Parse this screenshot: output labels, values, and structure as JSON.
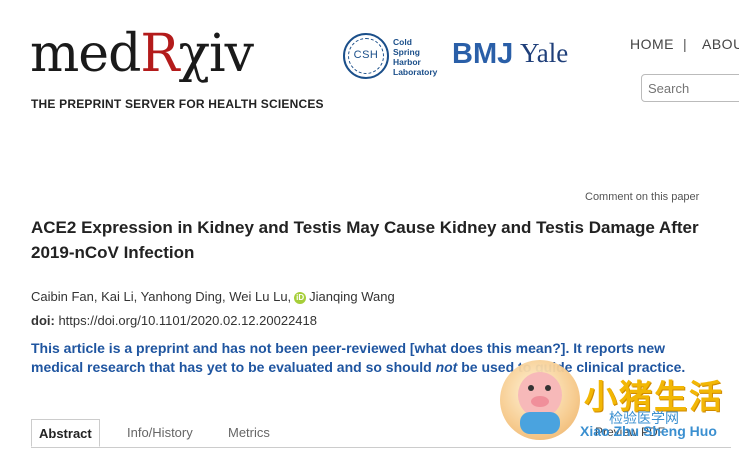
{
  "header": {
    "logo": {
      "part1": "med",
      "part2": "R",
      "part3": "χiv"
    },
    "tagline": "THE PREPRINT SERVER FOR HEALTH SCIENCES",
    "partners": {
      "csh_abbrev": "CSH",
      "csh_lines": [
        "Cold",
        "Spring",
        "Harbor",
        "Laboratory"
      ],
      "bmj": "BMJ",
      "yale": "Yale"
    },
    "nav": {
      "home": "HOME",
      "separator": "|",
      "about": "ABOUT"
    },
    "search": {
      "placeholder": "Search"
    }
  },
  "article": {
    "comment_link": "Comment on this paper",
    "title": "ACE2 Expression in Kidney and Testis May Cause Kidney and Testis Damage After 2019-nCoV Infection",
    "authors_before": "Caibin Fan, Kai Li, Yanhong Ding, Wei Lu Lu,",
    "orcid_badge": "iD",
    "authors_after": "Jianqing Wang",
    "doi_label": "doi:",
    "doi_value": "https://doi.org/10.1101/2020.02.12.20022418",
    "notice": {
      "part1": "This article is a preprint and has not been peer-reviewed [what does this mean?]. It reports new medical research that has yet to be evaluated and so should ",
      "emphasis": "not",
      "part2": " be used to guide clinical practice."
    }
  },
  "tabs": [
    {
      "label": "Abstract",
      "active": true
    },
    {
      "label": "Info/History",
      "active": false
    },
    {
      "label": "Metrics",
      "active": false
    }
  ],
  "preview_pdf": "Preview PDF",
  "watermark": {
    "title": "小猪生活",
    "subtitle": "检验医学网",
    "pinyin": "Xiao Zhu Sheng Huo"
  },
  "colors": {
    "brand_red": "#b31b1b",
    "notice_blue": "#1f55a0",
    "csh_blue": "#1b4f8a",
    "bmj_blue": "#2a5fa8",
    "yale_blue": "#1f3f7a"
  }
}
